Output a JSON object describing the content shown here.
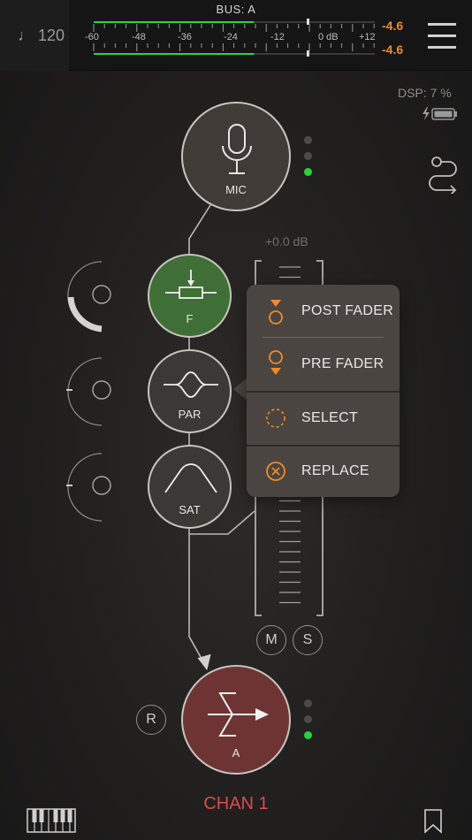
{
  "topbar": {
    "tempo": "♩ 120",
    "bus_label": "BUS: A",
    "meter_scale": [
      "-60",
      "-48",
      "-36",
      "-24",
      "-12",
      "0 dB",
      "+12"
    ],
    "meter_left_value": "-4.6",
    "meter_right_value": "-4.6",
    "meter_level_fraction": 0.57
  },
  "dsp": {
    "label": "DSP:  7 %"
  },
  "nodes": {
    "mic": "MIC",
    "filter": "F",
    "parametric": "PAR",
    "saturation": "SAT",
    "bus_out": "A"
  },
  "fader": {
    "gain_readout": "+0.0 dB",
    "mute_label": "M",
    "solo_label": "S"
  },
  "popup_menu": {
    "items": [
      {
        "label": "POST FADER",
        "icon": "post-fader-icon"
      },
      {
        "label": "PRE FADER",
        "icon": "pre-fader-icon"
      },
      {
        "label": "SELECT",
        "icon": "select-dashed-circle-icon"
      },
      {
        "label": "REPLACE",
        "icon": "replace-x-circle-icon"
      }
    ]
  },
  "record_label": "R",
  "channel_name": "CHAN 1",
  "colors": {
    "accent_orange": "#f08a2a",
    "meter_green": "#2fd33c",
    "filter_node": "#3f6e36",
    "bus_node": "#6e3434",
    "channel_red": "#d94c4c"
  }
}
